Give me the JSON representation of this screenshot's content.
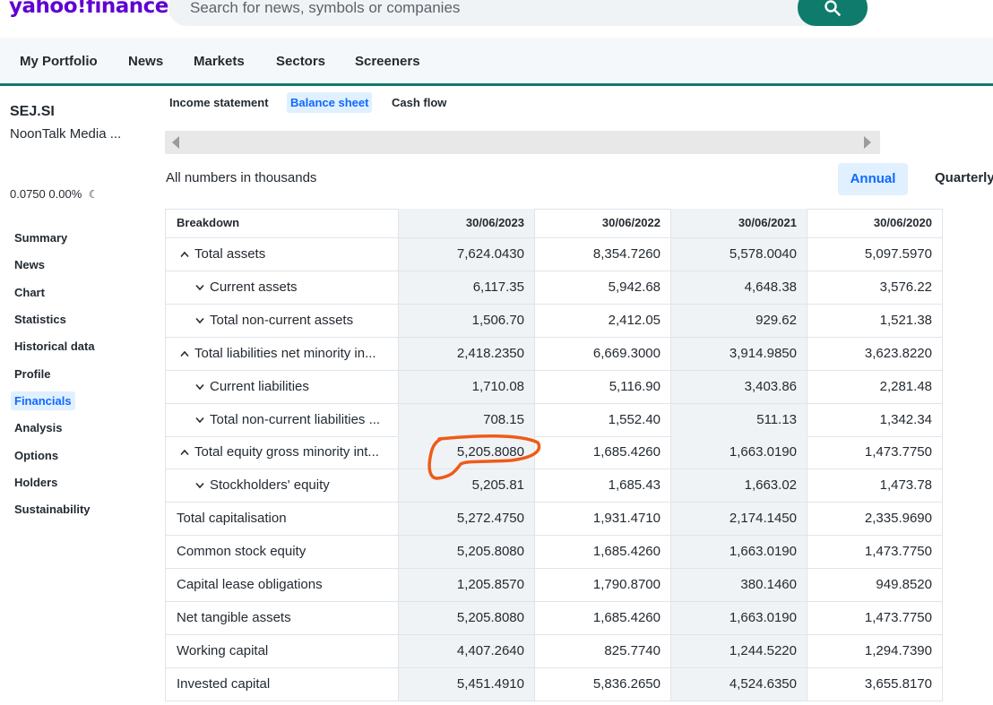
{
  "header": {
    "logo": "yahoo!finance",
    "search_placeholder": "Search for news, symbols or companies"
  },
  "nav": [
    "My Portfolio",
    "News",
    "Markets",
    "Sectors",
    "Screeners"
  ],
  "quote": {
    "ticker": "SEJ.SI",
    "company": "NoonTalk Media ...",
    "price": "0.0750",
    "change": "0.00%"
  },
  "sidebar": [
    "Summary",
    "News",
    "Chart",
    "Statistics",
    "Historical data",
    "Profile",
    "Financials",
    "Analysis",
    "Options",
    "Holders",
    "Sustainability"
  ],
  "tabs": [
    "Income statement",
    "Balance sheet",
    "Cash flow"
  ],
  "note": "All numbers in thousands",
  "period_buttons": {
    "annual": "Annual",
    "quarterly": "Quarterly"
  },
  "table": {
    "header": [
      "Breakdown",
      "30/06/2023",
      "30/06/2022",
      "30/06/2021",
      "30/06/2020"
    ],
    "rows": [
      {
        "label": "Total assets",
        "chev": "^",
        "level": 1,
        "values": [
          "7,624.0430",
          "8,354.7260",
          "5,578.0040",
          "5,097.5970"
        ]
      },
      {
        "label": "Current assets",
        "chev": "v",
        "level": 2,
        "values": [
          "6,117.35",
          "5,942.68",
          "4,648.38",
          "3,576.22"
        ]
      },
      {
        "label": "Total non-current assets",
        "chev": "v",
        "level": 2,
        "values": [
          "1,506.70",
          "2,412.05",
          "929.62",
          "1,521.38"
        ]
      },
      {
        "label": "Total liabilities net minority in...",
        "chev": "^",
        "level": 1,
        "values": [
          "2,418.2350",
          "6,669.3000",
          "3,914.9850",
          "3,623.8220"
        ]
      },
      {
        "label": "Current liabilities",
        "chev": "v",
        "level": 2,
        "values": [
          "1,710.08",
          "5,116.90",
          "3,403.86",
          "2,281.48"
        ]
      },
      {
        "label": "Total non-current liabilities ...",
        "chev": "v",
        "level": 2,
        "values": [
          "708.15",
          "1,552.40",
          "511.13",
          "1,342.34"
        ]
      },
      {
        "label": "Total equity gross minority int...",
        "chev": "^",
        "level": 1,
        "values": [
          "5,205.8080",
          "1,685.4260",
          "1,663.0190",
          "1,473.7750"
        ]
      },
      {
        "label": "Stockholders' equity",
        "chev": "v",
        "level": 2,
        "values": [
          "5,205.81",
          "1,685.43",
          "1,663.02",
          "1,473.78"
        ]
      },
      {
        "label": "Total capitalisation",
        "chev": "",
        "level": 0,
        "values": [
          "5,272.4750",
          "1,931.4710",
          "2,174.1450",
          "2,335.9690"
        ]
      },
      {
        "label": "Common stock equity",
        "chev": "",
        "level": 0,
        "values": [
          "5,205.8080",
          "1,685.4260",
          "1,663.0190",
          "1,473.7750"
        ]
      },
      {
        "label": "Capital lease obligations",
        "chev": "",
        "level": 0,
        "values": [
          "1,205.8570",
          "1,790.8700",
          "380.1460",
          "949.8520"
        ]
      },
      {
        "label": "Net tangible assets",
        "chev": "",
        "level": 0,
        "values": [
          "5,205.8080",
          "1,685.4260",
          "1,663.0190",
          "1,473.7750"
        ]
      },
      {
        "label": "Working capital",
        "chev": "",
        "level": 0,
        "values": [
          "4,407.2640",
          "825.7740",
          "1,244.5220",
          "1,294.7390"
        ]
      },
      {
        "label": "Invested capital",
        "chev": "",
        "level": 0,
        "values": [
          "5,451.4910",
          "5,836.2650",
          "4,524.6350",
          "3,655.8170"
        ]
      }
    ]
  },
  "colors": {
    "brand": "#6001d2",
    "accent": "#0f7b6c",
    "active": "#0f69ff",
    "annotation": "#f05a1a"
  }
}
